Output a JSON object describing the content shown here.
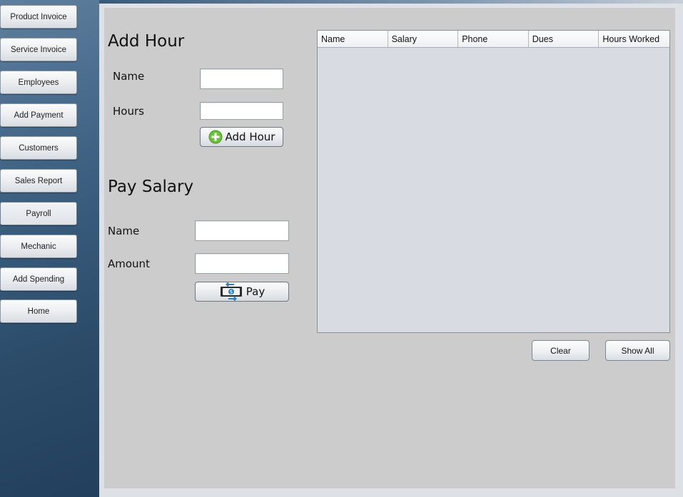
{
  "sidebar": {
    "items": [
      {
        "label": "Product Invoice"
      },
      {
        "label": "Service Invoice"
      },
      {
        "label": "Employees"
      },
      {
        "label": "Add Payment"
      },
      {
        "label": "Customers"
      },
      {
        "label": "Sales Report"
      },
      {
        "label": "Payroll"
      },
      {
        "label": "Mechanic"
      },
      {
        "label": "Add Spending"
      },
      {
        "label": "Home"
      }
    ],
    "active": "Payroll"
  },
  "add_hour": {
    "title": "Add Hour",
    "name_label": "Name",
    "name_value": "",
    "hours_label": "Hours",
    "hours_value": "",
    "button_label": "Add Hour",
    "button_icon": "plus-circle-icon"
  },
  "pay_salary": {
    "title": "Pay Salary",
    "name_label": "Name",
    "name_value": "",
    "amount_label": "Amount",
    "amount_value": "",
    "button_label": "Pay",
    "button_icon": "money-transfer-icon"
  },
  "table": {
    "columns": [
      "Name",
      "Salary",
      "Phone",
      "Dues",
      "Hours Worked"
    ],
    "rows": []
  },
  "actions": {
    "clear_label": "Clear",
    "show_all_label": "Show All"
  },
  "colors": {
    "panel_bg": "#cccccc",
    "sidebar_bg": "#2b4b69",
    "table_bg": "#d8dbe2",
    "add_icon_green": "#6fbf3d",
    "pay_icon_blue": "#2e7fc1"
  }
}
